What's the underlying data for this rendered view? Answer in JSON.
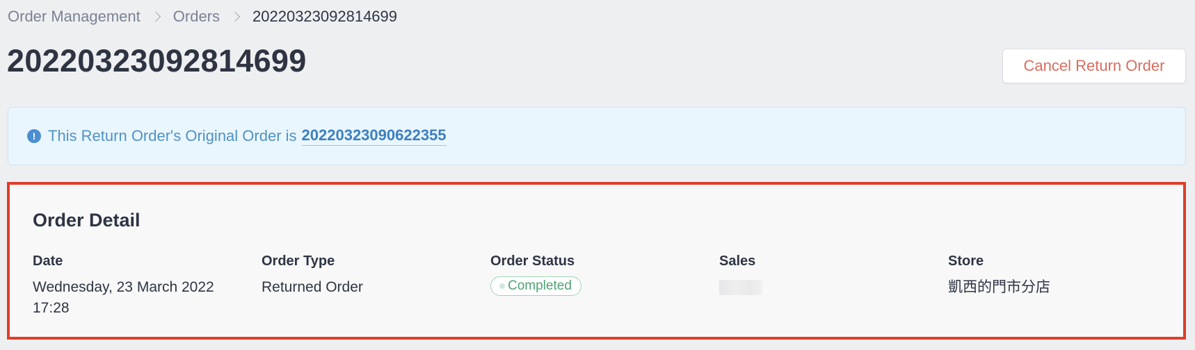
{
  "breadcrumb": {
    "items": [
      "Order Management",
      "Orders"
    ],
    "current": "20220323092814699"
  },
  "page": {
    "title": "20220323092814699"
  },
  "actions": {
    "cancel_return_order": "Cancel Return Order"
  },
  "banner": {
    "icon": "exclamation-circle-icon",
    "text": "This Return Order's Original Order is",
    "link": "20220323090622355"
  },
  "order_detail": {
    "title": "Order Detail",
    "fields": {
      "date": {
        "label": "Date",
        "value_line1": "Wednesday, 23 March 2022",
        "value_line2": "17:28"
      },
      "order_type": {
        "label": "Order Type",
        "value": "Returned Order"
      },
      "order_status": {
        "label": "Order Status",
        "value": "Completed"
      },
      "sales": {
        "label": "Sales",
        "value": ""
      },
      "store": {
        "label": "Store",
        "value": "凱西的門市分店"
      }
    }
  },
  "colors": {
    "highlight_border": "#dd3e28",
    "cancel_text": "#d96d5e",
    "info_text": "#4f92c4",
    "status_green": "#4ea273"
  }
}
